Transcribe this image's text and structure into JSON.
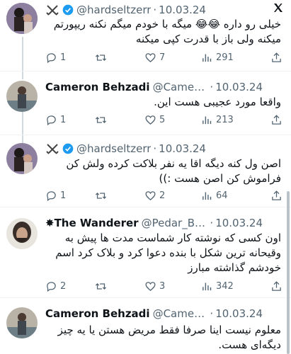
{
  "tweets": [
    {
      "avatar": "avatar-photo",
      "display_name": "",
      "handle": "@hardseltzerr",
      "separator": "·",
      "date": "10.03.24",
      "prefix_icon": "crossed-swords-icon",
      "verified": true,
      "text": "خیلی رو داره 😂😂 میگه با خودم میگم نکنه ریپورتم میکنه ولی باز با قدرت کپی میکنه",
      "replies": "1",
      "retweets": "",
      "likes": "7",
      "views": "291"
    },
    {
      "avatar": "avatar-photo",
      "display_name": "Cameron Behzadi",
      "handle": "@CameronBehzadi",
      "separator": "·",
      "date": "10.03.24",
      "text": "واقعا مورد عجیبی هست این.",
      "replies": "1",
      "retweets": "",
      "likes": "5",
      "views": "213"
    },
    {
      "avatar": "avatar-photo",
      "display_name": "",
      "handle": "@hardseltzerr",
      "separator": "·",
      "date": "10.03.24",
      "prefix_icon": "crossed-swords-icon",
      "verified": true,
      "text": "اصن ول کنه دیگه اقا یه نفر بلاکت کرده ولش کن فراموش کن اصن هست :))",
      "replies": "1",
      "retweets": "",
      "likes": "2",
      "views": "64"
    },
    {
      "avatar": "avatar-photo",
      "display_name": "The Wanderer",
      "name_prefix": "✸",
      "handle": "@Pedar_Bozorg",
      "separator": "·",
      "date": "10.03.24",
      "text": "اون کسی که نوشته کار شماست مدت ها پیش به وقیحانه ترین شکل با بنده دعوا کرد و بلاک کرد اسم خودشم گذاشته مبارز",
      "replies": "2",
      "retweets": "",
      "likes": "3",
      "views": "342"
    },
    {
      "avatar": "avatar-photo",
      "display_name": "Cameron Behzadi",
      "handle": "@CameronBehzadi",
      "separator": "·",
      "date": "10.03.24",
      "text": "معلوم نیست اینا صرفا فقط مریض هستن یا یه چیز دیگه‌ای هست."
    }
  ],
  "colors": {
    "verified": "#1d9bf0",
    "muted": "#536471",
    "divider": "#eff3f4",
    "thread_line": "#cfd9de"
  }
}
